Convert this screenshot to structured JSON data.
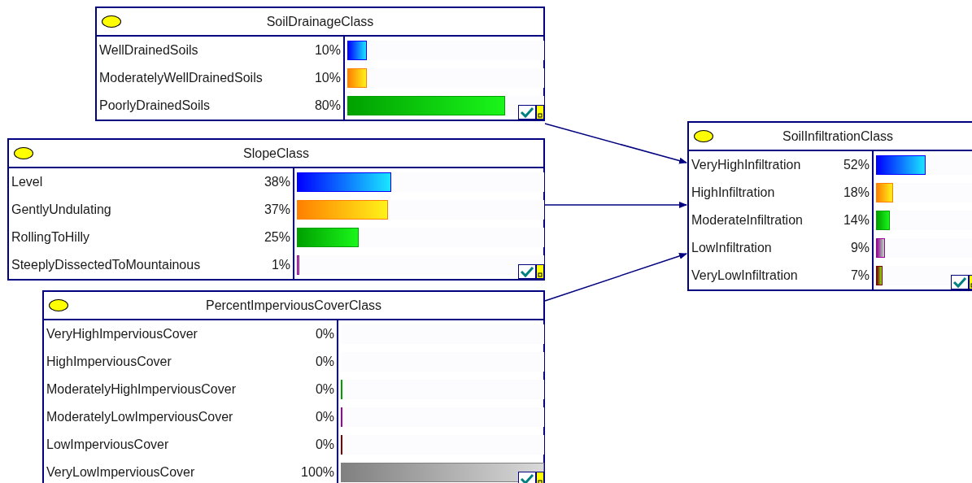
{
  "nodes": [
    {
      "title": "SoilDrainageClass",
      "states": [
        {
          "label": "WellDrainedSoils",
          "value": "10%",
          "level": 0.1,
          "color": "#0000ff"
        },
        {
          "label": "ModeratelyWellDrainedSoils",
          "value": "10%",
          "level": 0.1,
          "color": "#ff8000"
        },
        {
          "label": "PoorlyDrainedSoils",
          "value": "80%",
          "level": 0.8,
          "color": "#00a000"
        }
      ]
    },
    {
      "title": "SlopeClass",
      "states": [
        {
          "label": "Level",
          "value": "38%",
          "level": 0.38,
          "color": "#0000ff"
        },
        {
          "label": "GentlyUndulating",
          "value": "37%",
          "level": 0.37,
          "color": "#ff8000"
        },
        {
          "label": "RollingToHilly",
          "value": "25%",
          "level": 0.25,
          "color": "#00a000"
        },
        {
          "label": "SteeplyDissectedToMountainous",
          "value": "1%",
          "level": 0.01,
          "color": "#a000a0"
        }
      ]
    },
    {
      "title": "PercentImperviousCoverClass",
      "states": [
        {
          "label": "VeryHighImperviousCover",
          "value": "0%"
        },
        {
          "label": "HighImperviousCover",
          "value": "0%"
        },
        {
          "label": "ModeratelyHighImperviousCover",
          "value": "0%",
          "level": 0.004,
          "color": "#00a000"
        },
        {
          "label": "ModeratelyLowImperviousCover",
          "value": "0%",
          "level": 0.004,
          "color": "#a000a0"
        },
        {
          "label": "LowImperviousCover",
          "value": "0%",
          "level": 0.004,
          "color": "#800000"
        },
        {
          "label": "VeryLowImperviousCover",
          "value": "100%",
          "level": 1,
          "color": "#808080"
        }
      ]
    },
    {
      "title": "SoilInfiltrationClass",
      "states": [
        {
          "label": "VeryHighInfiltration",
          "value": "52%",
          "level": 0.52,
          "color": "#0000ff"
        },
        {
          "label": "HighInfiltration",
          "value": "18%",
          "level": 0.18,
          "color": "#ff8000"
        },
        {
          "label": "ModerateInfiltration",
          "value": "14%",
          "level": 0.14,
          "color": "#00a000"
        },
        {
          "label": "LowInfiltration",
          "value": "9%",
          "level": 0.09,
          "color": "#a000a0"
        },
        {
          "label": "VeryLowInfiltration",
          "value": "7%",
          "level": 0.07,
          "color": "#800000"
        }
      ]
    }
  ]
}
